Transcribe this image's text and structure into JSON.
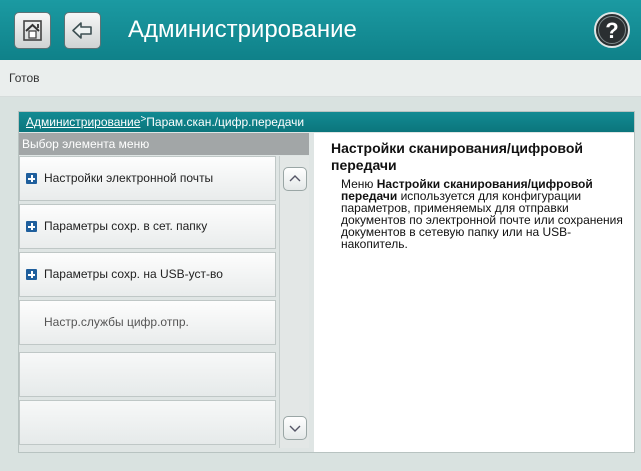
{
  "header": {
    "title": "Администрирование",
    "home_icon": "home-icon",
    "back_icon": "back-icon",
    "help_icon": "help-icon"
  },
  "status": {
    "text": "Готов"
  },
  "breadcrumb": {
    "link": "Администрирование",
    "separator": ">",
    "current": "Парам.скан./цифр.передачи"
  },
  "menu": {
    "header": "Выбор элемента меню",
    "items": [
      {
        "label": "Настройки электронной почты",
        "icon": "plus-icon"
      },
      {
        "label": "Параметры сохр. в сет. папку",
        "icon": "plus-icon"
      },
      {
        "label": "Параметры сохр. на USB-уст-во",
        "icon": "plus-icon"
      },
      {
        "label": "Настр.службы цифр.отпр.",
        "icon": ""
      },
      {
        "label": "",
        "icon": ""
      },
      {
        "label": "",
        "icon": ""
      }
    ]
  },
  "detail": {
    "title": "Настройки сканирования/цифровой передачи",
    "body_prefix": "Меню ",
    "body_bold": "Настройки сканирования/цифровой передачи",
    "body_suffix": " используется для конфигурации параметров, применяемых для отправки документов по электронной почте или сохранения документов в сетевую папку или на USB-накопитель."
  },
  "colors": {
    "accent": "#0f8189",
    "plus_icon": "#1f5f9d"
  }
}
